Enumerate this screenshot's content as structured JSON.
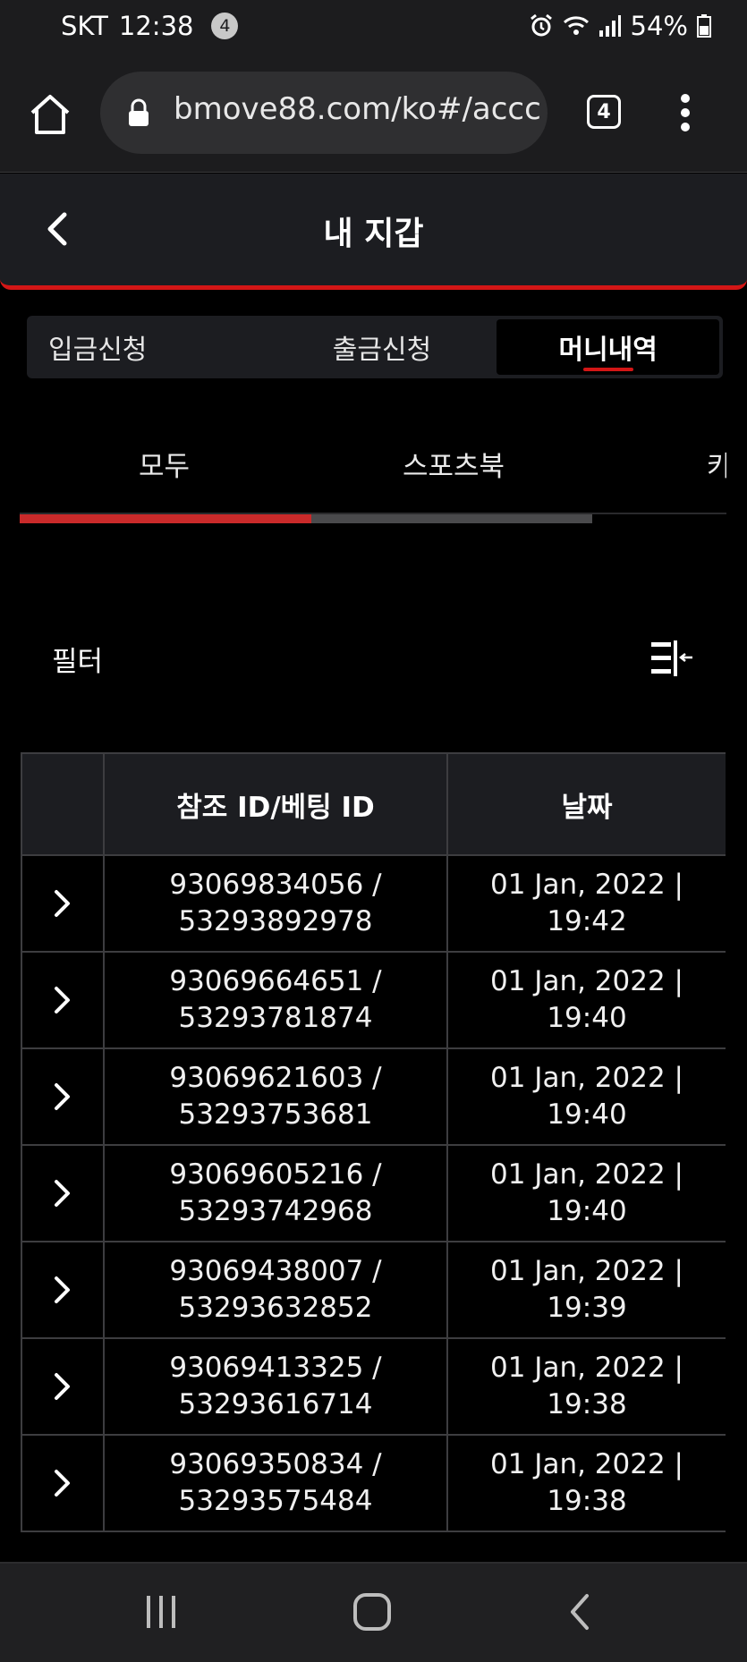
{
  "status_bar": {
    "carrier": "SKT",
    "time": "12:38",
    "notification_count": "4",
    "battery": "54%"
  },
  "browser": {
    "url": "bmove88.com/ko#/accc",
    "tab_count": "4"
  },
  "header": {
    "title": "내 지갑"
  },
  "main_tabs": [
    {
      "label": "입금신청"
    },
    {
      "label": "출금신청"
    },
    {
      "label": "머니내역"
    }
  ],
  "sub_tabs": [
    {
      "label": "모두"
    },
    {
      "label": "스포츠북"
    },
    {
      "label": "카"
    }
  ],
  "sub_tab_scroll_fraction": 0.81,
  "sub_tab_active_fraction": 0.51,
  "filter": {
    "label": "필터"
  },
  "table": {
    "columns": [
      "",
      "참조 ID/베팅 ID",
      "날짜"
    ],
    "rows": [
      {
        "ref_id": "93069834056 /",
        "bet_id": "53293892978",
        "date": "01 Jan, 2022 |",
        "time": "19:42"
      },
      {
        "ref_id": "93069664651 /",
        "bet_id": "53293781874",
        "date": "01 Jan, 2022 |",
        "time": "19:40"
      },
      {
        "ref_id": "93069621603 /",
        "bet_id": "53293753681",
        "date": "01 Jan, 2022 |",
        "time": "19:40"
      },
      {
        "ref_id": "93069605216 /",
        "bet_id": "53293742968",
        "date": "01 Jan, 2022 |",
        "time": "19:40"
      },
      {
        "ref_id": "93069438007 /",
        "bet_id": "53293632852",
        "date": "01 Jan, 2022 |",
        "time": "19:39"
      },
      {
        "ref_id": "93069413325 /",
        "bet_id": "53293616714",
        "date": "01 Jan, 2022 |",
        "time": "19:38"
      },
      {
        "ref_id": "93069350834 /",
        "bet_id": "53293575484",
        "date": "01 Jan, 2022 |",
        "time": "19:38"
      }
    ]
  },
  "colors": {
    "accent": "#d31616",
    "background": "#000000",
    "header_bg": "#1c1d21"
  }
}
